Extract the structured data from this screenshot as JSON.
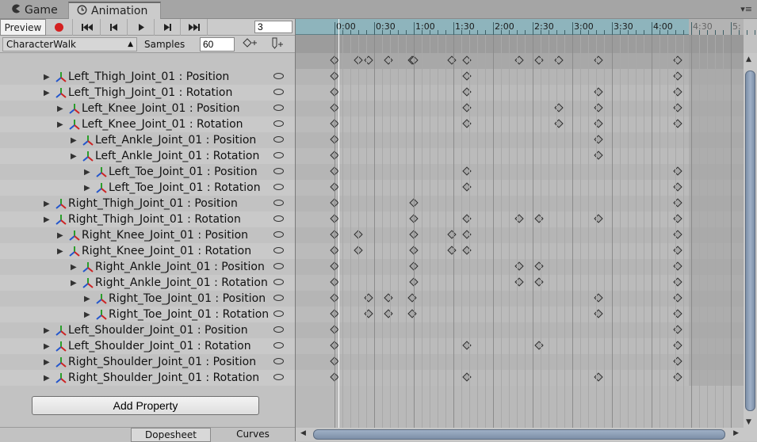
{
  "tabs": [
    {
      "label": "Game",
      "icon": "pacman-icon"
    },
    {
      "label": "Animation",
      "icon": "clock-icon"
    }
  ],
  "toolbar": {
    "preview_label": "Preview",
    "frame_value": "3"
  },
  "clip": {
    "name": "CharacterWalk",
    "samples_label": "Samples",
    "samples_value": "60"
  },
  "ruler": {
    "labels": [
      "0:00",
      "0:30",
      "1:00",
      "1:30",
      "2:00",
      "2:30",
      "3:00",
      "3:30",
      "4:00",
      "4:30",
      "5:"
    ]
  },
  "properties": [
    {
      "label": "Left_Thigh_Joint_01 : Position",
      "indent": 0,
      "keys": [
        0,
        100,
        260
      ]
    },
    {
      "label": "Left_Thigh_Joint_01 : Rotation",
      "indent": 0,
      "keys": [
        0,
        100,
        200,
        260
      ]
    },
    {
      "label": "Left_Knee_Joint_01 : Position",
      "indent": 1,
      "keys": [
        0,
        100,
        170,
        200,
        260
      ]
    },
    {
      "label": "Left_Knee_Joint_01 : Rotation",
      "indent": 1,
      "keys": [
        0,
        100,
        170,
        200,
        260
      ]
    },
    {
      "label": "Left_Ankle_Joint_01 : Position",
      "indent": 2,
      "keys": [
        0,
        200
      ]
    },
    {
      "label": "Left_Ankle_Joint_01 : Rotation",
      "indent": 2,
      "keys": [
        0,
        200
      ]
    },
    {
      "label": "Left_Toe_Joint_01 : Position",
      "indent": 3,
      "keys": [
        0,
        100,
        260
      ]
    },
    {
      "label": "Left_Toe_Joint_01 : Rotation",
      "indent": 3,
      "keys": [
        0,
        100,
        260
      ]
    },
    {
      "label": "Right_Thigh_Joint_01 : Position",
      "indent": 0,
      "keys": [
        0,
        60,
        260
      ]
    },
    {
      "label": "Right_Thigh_Joint_01 : Rotation",
      "indent": 0,
      "keys": [
        0,
        60,
        100,
        140,
        155,
        200,
        260
      ]
    },
    {
      "label": "Right_Knee_Joint_01 : Position",
      "indent": 1,
      "keys": [
        0,
        18,
        60,
        89,
        100,
        260
      ]
    },
    {
      "label": "Right_Knee_Joint_01 : Rotation",
      "indent": 1,
      "keys": [
        0,
        18,
        60,
        89,
        100,
        260
      ]
    },
    {
      "label": "Right_Ankle_Joint_01 : Position",
      "indent": 2,
      "keys": [
        0,
        60,
        140,
        155,
        260
      ]
    },
    {
      "label": "Right_Ankle_Joint_01 : Rotation",
      "indent": 2,
      "keys": [
        0,
        60,
        140,
        155,
        260
      ]
    },
    {
      "label": "Right_Toe_Joint_01 : Position",
      "indent": 3,
      "keys": [
        0,
        26,
        41,
        59,
        200,
        260
      ]
    },
    {
      "label": "Right_Toe_Joint_01 : Rotation",
      "indent": 3,
      "keys": [
        0,
        26,
        41,
        59,
        200,
        260
      ]
    },
    {
      "label": "Left_Shoulder_Joint_01 : Position",
      "indent": 0,
      "keys": [
        0,
        260
      ]
    },
    {
      "label": "Left_Shoulder_Joint_01 : Rotation",
      "indent": 0,
      "keys": [
        0,
        100,
        155,
        260
      ]
    },
    {
      "label": "Right_Shoulder_Joint_01 : Position",
      "indent": 0,
      "keys": [
        0,
        260
      ]
    },
    {
      "label": "Right_Shoulder_Joint_01 : Rotation",
      "indent": 0,
      "keys": [
        0,
        100,
        200,
        260
      ]
    }
  ],
  "summary_keys": [
    0,
    18,
    26,
    41,
    59,
    60,
    89,
    100,
    140,
    155,
    170,
    200,
    260
  ],
  "playhead_frame": 3,
  "add_property_label": "Add Property",
  "bottom_tabs": {
    "dopesheet": "Dopesheet",
    "curves": "Curves"
  },
  "colors": {
    "ruler": "#8eb4bc",
    "record": "#d42020",
    "accent_blue": "#7d8fa8"
  }
}
